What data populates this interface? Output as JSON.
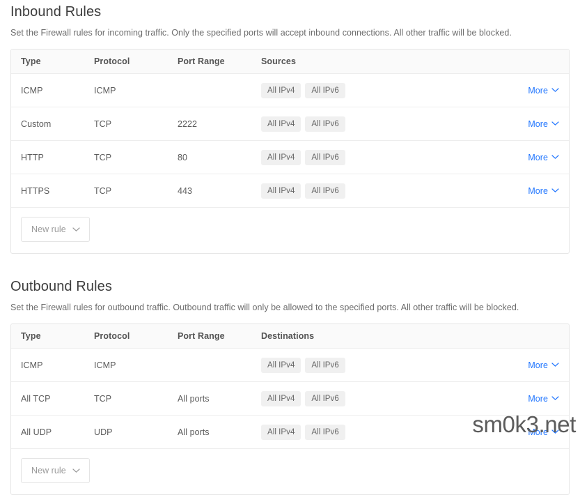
{
  "watermark": "sm0k3.net",
  "colors": {
    "link": "#2176ff",
    "chip_bg": "#f0f0f0",
    "header_bg": "#fafafa",
    "border": "#e6e6e6"
  },
  "inbound": {
    "title": "Inbound Rules",
    "description": "Set the Firewall rules for incoming traffic. Only the specified ports will accept inbound connections. All other traffic will be blocked.",
    "columns": [
      "Type",
      "Protocol",
      "Port Range",
      "Sources"
    ],
    "more_label": "More",
    "new_rule_label": "New rule",
    "rows": [
      {
        "type": "ICMP",
        "protocol": "ICMP",
        "port_range": "",
        "chips": [
          "All IPv4",
          "All IPv6"
        ],
        "more": "More"
      },
      {
        "type": "Custom",
        "protocol": "TCP",
        "port_range": "2222",
        "chips": [
          "All IPv4",
          "All IPv6"
        ],
        "more": "More"
      },
      {
        "type": "HTTP",
        "protocol": "TCP",
        "port_range": "80",
        "chips": [
          "All IPv4",
          "All IPv6"
        ],
        "more": "More"
      },
      {
        "type": "HTTPS",
        "protocol": "TCP",
        "port_range": "443",
        "chips": [
          "All IPv4",
          "All IPv6"
        ],
        "more": "More"
      }
    ]
  },
  "outbound": {
    "title": "Outbound Rules",
    "description": "Set the Firewall rules for outbound traffic. Outbound traffic will only be allowed to the specified ports. All other traffic will be blocked.",
    "columns": [
      "Type",
      "Protocol",
      "Port Range",
      "Destinations"
    ],
    "more_label": "More",
    "new_rule_label": "New rule",
    "rows": [
      {
        "type": "ICMP",
        "protocol": "ICMP",
        "port_range": "",
        "chips": [
          "All IPv4",
          "All IPv6"
        ],
        "more": "More"
      },
      {
        "type": "All TCP",
        "protocol": "TCP",
        "port_range": "All ports",
        "chips": [
          "All IPv4",
          "All IPv6"
        ],
        "more": "More"
      },
      {
        "type": "All UDP",
        "protocol": "UDP",
        "port_range": "All ports",
        "chips": [
          "All IPv4",
          "All IPv6"
        ],
        "more": "More"
      }
    ]
  }
}
